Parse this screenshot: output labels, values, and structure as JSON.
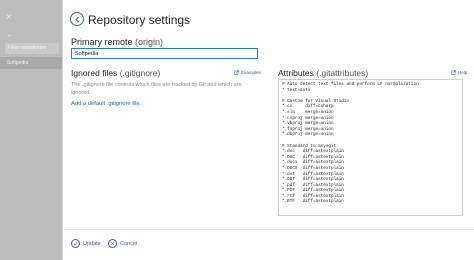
{
  "sidebar": {
    "close_glyph": "×",
    "nav_glyph": "←",
    "filter_placeholder": "Filter repositories",
    "item": "Softpedia"
  },
  "header": {
    "title": "Repository settings"
  },
  "primary_remote": {
    "label": "Primary remote",
    "label_sub": "(origin)",
    "value": "Softpedia"
  },
  "ignored_files": {
    "title": "Ignored files",
    "title_sub": "(.gitignore)",
    "examples_link": "Examples",
    "description": "The .gitignore file controls which files are tracked by Git and which are ignored.",
    "add_default": "Add a default .gitignore file."
  },
  "attributes": {
    "title": "Attributes",
    "title_sub": "(.gitattributes)",
    "help_link": "Help",
    "content": "# Auto detect text files and perform LF normalization\n* text=auto\n\n# Custom for Visual Studio\n*.cs     diff=csharp\n*.sln    merge=union\n*.csproj merge=union\n*.vbproj merge=union\n*.fsproj merge=union\n*.dbproj merge=union\n\n# Standard to msysgit\n*.doc   diff=astextplain\n*.DOC   diff=astextplain\n*.docx  diff=astextplain\n*.DOCX  diff=astextplain\n*.dot   diff=astextplain\n*.DOT   diff=astextplain\n*.pdf   diff=astextplain\n*.PDF   diff=astextplain\n*.rtf   diff=astextplain\n*.RTF   diff=astextplain"
  },
  "footer": {
    "update_label": "Update",
    "cancel_label": "Cancel"
  },
  "colors": {
    "accent": "#3f5ea8",
    "link": "#2b62b0",
    "input_focus": "#2b79d0",
    "sidebar": "#bcbcbc"
  }
}
